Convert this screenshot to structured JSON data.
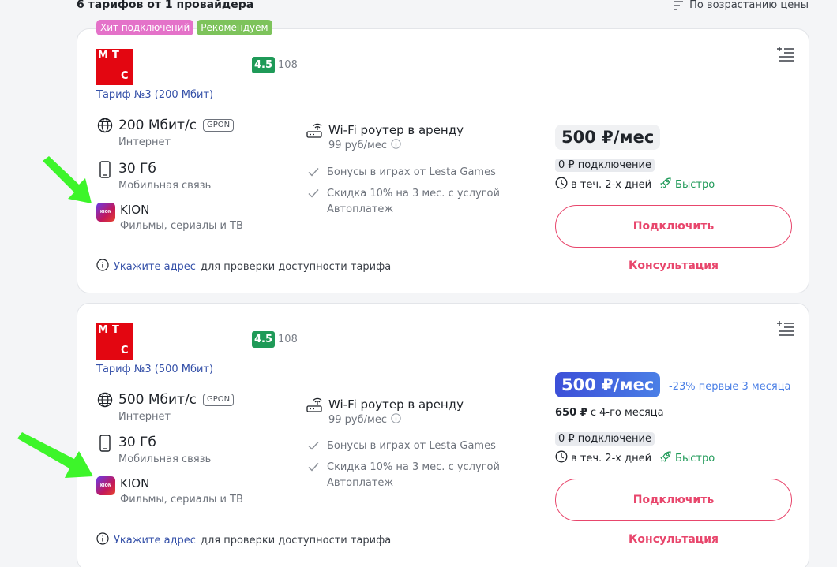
{
  "header": {
    "count_text": "6 тарифов от 1 провайдера",
    "sort_label": "По возрастанию цены"
  },
  "colors": {
    "accent": "#e8466c",
    "link": "#3450a8",
    "rating": "#1f9a58",
    "mts_red": "#e30611",
    "promo_blue": "#4a7fe6",
    "annotation_arrow": "#3df52a"
  },
  "cards": [
    {
      "badges": [
        "Хит подключений",
        "Рекомендуем"
      ],
      "logo_letters": [
        "М",
        "Т",
        "С"
      ],
      "rating": "4.5",
      "reviews": "108",
      "tariff_name": "Тариф №3 (200 Мбит)",
      "internet": {
        "title": "200 Мбит/с",
        "tag": "GPON",
        "sub": "Интернет",
        "icon": "globe-icon"
      },
      "mobile": {
        "title": "30 Гб",
        "sub": "Мобильная связь",
        "icon": "phone-icon"
      },
      "tv": {
        "title": "KION",
        "sub": "Фильмы, сериалы и ТВ",
        "icon": "kion-logo"
      },
      "router": {
        "title": "Wi-Fi роутер в аренду",
        "sub": "99 руб/мес",
        "icon": "router-icon"
      },
      "bonus1": "Бонусы в играх от Lesta Games",
      "bonus2_line1": "Скидка 10% на 3 мес. с услугой",
      "bonus2_line2": "Автоплатеж",
      "address_link": "Укажите адрес",
      "address_rest": "для проверки доступности тарифа",
      "price": "500 ₽/мес",
      "connection_fee": "0 ₽ подключение",
      "connect_time": "в теч. 2-х дней",
      "fast_label": "Быстро",
      "connect_button": "Подключить",
      "consult_button": "Консультация"
    },
    {
      "logo_letters": [
        "М",
        "Т",
        "С"
      ],
      "rating": "4.5",
      "reviews": "108",
      "tariff_name": "Тариф №3 (500 Мбит)",
      "internet": {
        "title": "500 Мбит/с",
        "tag": "GPON",
        "sub": "Интернет",
        "icon": "globe-icon"
      },
      "mobile": {
        "title": "30 Гб",
        "sub": "Мобильная связь",
        "icon": "phone-icon"
      },
      "tv": {
        "title": "KION",
        "sub": "Фильмы, сериалы и ТВ",
        "icon": "kion-logo"
      },
      "router": {
        "title": "Wi-Fi роутер в аренду",
        "sub": "99 руб/мес",
        "icon": "router-icon"
      },
      "bonus1": "Бонусы в играх от Lesta Games",
      "bonus2_line1": "Скидка 10% на 3 мес. с услугой",
      "bonus2_line2": "Автоплатеж",
      "address_link": "Укажите адрес",
      "address_rest": "для проверки доступности тарифа",
      "price": "500 ₽/мес",
      "discount": "-23% первые 3 месяца",
      "after_price": "650 ₽",
      "after_text": "с 4-го месяца",
      "connection_fee": "0 ₽ подключение",
      "connect_time": "в теч. 2-х дней",
      "fast_label": "Быстро",
      "connect_button": "Подключить",
      "consult_button": "Консультация"
    }
  ]
}
